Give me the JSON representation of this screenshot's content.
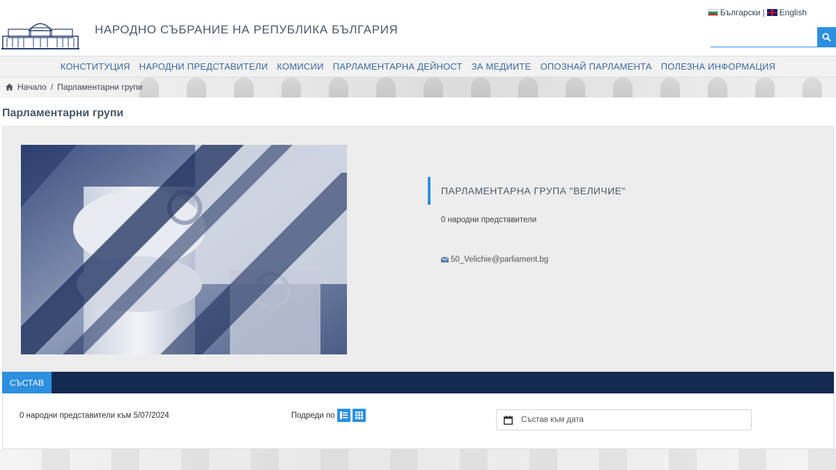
{
  "header": {
    "title": "НАРОДНО СЪБРАНИЕ НА РЕПУБЛИКА БЪЛГАРИЯ",
    "lang_bg": "Български",
    "lang_sep": "|",
    "lang_en": "English",
    "search_placeholder": ""
  },
  "nav": {
    "items": [
      "КОНСТИТУЦИЯ",
      "НАРОДНИ ПРЕДСТАВИТЕЛИ",
      "КОМИСИИ",
      "ПАРЛАМЕНТАРНА ДЕЙНОСТ",
      "ЗА МЕДИИТЕ",
      "ОПОЗНАЙ ПАРЛАМЕНТА",
      "ПОЛЕЗНА ИНФОРМАЦИЯ"
    ]
  },
  "breadcrumb": {
    "home": "Начало",
    "sep": "/",
    "current": "Парламентарни групи"
  },
  "page": {
    "title": "Парламентарни групи"
  },
  "group": {
    "name": "ПАРЛАМЕНТАРНА ГРУПА \"ВЕЛИЧИЕ\"",
    "members": "0 народни представители",
    "email": "50_Velichie@parliament.bg"
  },
  "tabs": {
    "active": "СЪСТАВ"
  },
  "panel": {
    "count": "0 народни представители към 5/07/2024",
    "sort_label": "Подреди по",
    "date_placeholder": "Състав към дата"
  },
  "colors": {
    "accent": "#2d8fe0",
    "navy": "#142a52",
    "nav_text": "#3a6aa0"
  }
}
